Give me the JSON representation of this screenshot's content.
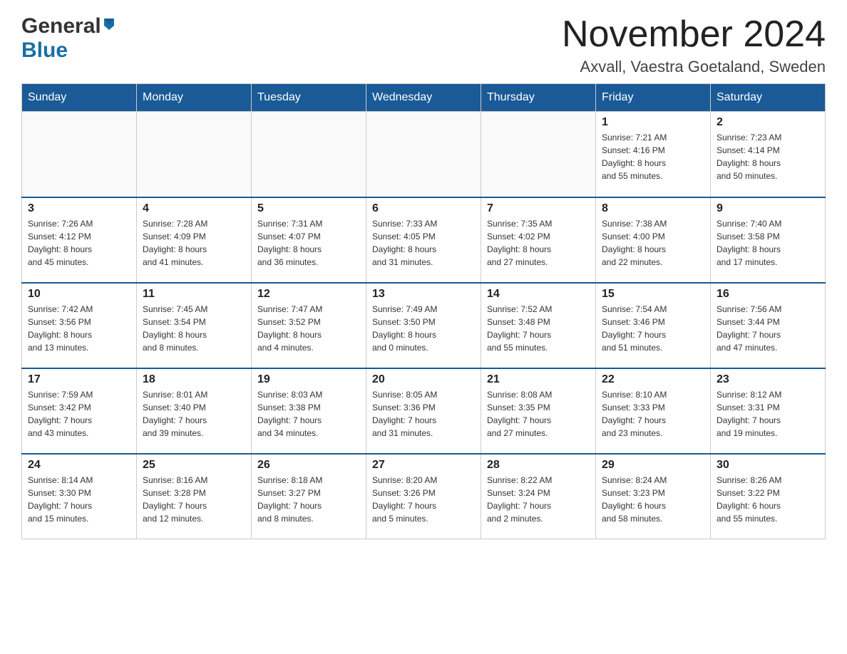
{
  "header": {
    "logo_general": "General",
    "logo_blue": "Blue",
    "month_title": "November 2024",
    "location": "Axvall, Vaestra Goetaland, Sweden"
  },
  "weekdays": [
    "Sunday",
    "Monday",
    "Tuesday",
    "Wednesday",
    "Thursday",
    "Friday",
    "Saturday"
  ],
  "weeks": [
    [
      {
        "day": "",
        "info": ""
      },
      {
        "day": "",
        "info": ""
      },
      {
        "day": "",
        "info": ""
      },
      {
        "day": "",
        "info": ""
      },
      {
        "day": "",
        "info": ""
      },
      {
        "day": "1",
        "info": "Sunrise: 7:21 AM\nSunset: 4:16 PM\nDaylight: 8 hours\nand 55 minutes."
      },
      {
        "day": "2",
        "info": "Sunrise: 7:23 AM\nSunset: 4:14 PM\nDaylight: 8 hours\nand 50 minutes."
      }
    ],
    [
      {
        "day": "3",
        "info": "Sunrise: 7:26 AM\nSunset: 4:12 PM\nDaylight: 8 hours\nand 45 minutes."
      },
      {
        "day": "4",
        "info": "Sunrise: 7:28 AM\nSunset: 4:09 PM\nDaylight: 8 hours\nand 41 minutes."
      },
      {
        "day": "5",
        "info": "Sunrise: 7:31 AM\nSunset: 4:07 PM\nDaylight: 8 hours\nand 36 minutes."
      },
      {
        "day": "6",
        "info": "Sunrise: 7:33 AM\nSunset: 4:05 PM\nDaylight: 8 hours\nand 31 minutes."
      },
      {
        "day": "7",
        "info": "Sunrise: 7:35 AM\nSunset: 4:02 PM\nDaylight: 8 hours\nand 27 minutes."
      },
      {
        "day": "8",
        "info": "Sunrise: 7:38 AM\nSunset: 4:00 PM\nDaylight: 8 hours\nand 22 minutes."
      },
      {
        "day": "9",
        "info": "Sunrise: 7:40 AM\nSunset: 3:58 PM\nDaylight: 8 hours\nand 17 minutes."
      }
    ],
    [
      {
        "day": "10",
        "info": "Sunrise: 7:42 AM\nSunset: 3:56 PM\nDaylight: 8 hours\nand 13 minutes."
      },
      {
        "day": "11",
        "info": "Sunrise: 7:45 AM\nSunset: 3:54 PM\nDaylight: 8 hours\nand 8 minutes."
      },
      {
        "day": "12",
        "info": "Sunrise: 7:47 AM\nSunset: 3:52 PM\nDaylight: 8 hours\nand 4 minutes."
      },
      {
        "day": "13",
        "info": "Sunrise: 7:49 AM\nSunset: 3:50 PM\nDaylight: 8 hours\nand 0 minutes."
      },
      {
        "day": "14",
        "info": "Sunrise: 7:52 AM\nSunset: 3:48 PM\nDaylight: 7 hours\nand 55 minutes."
      },
      {
        "day": "15",
        "info": "Sunrise: 7:54 AM\nSunset: 3:46 PM\nDaylight: 7 hours\nand 51 minutes."
      },
      {
        "day": "16",
        "info": "Sunrise: 7:56 AM\nSunset: 3:44 PM\nDaylight: 7 hours\nand 47 minutes."
      }
    ],
    [
      {
        "day": "17",
        "info": "Sunrise: 7:59 AM\nSunset: 3:42 PM\nDaylight: 7 hours\nand 43 minutes."
      },
      {
        "day": "18",
        "info": "Sunrise: 8:01 AM\nSunset: 3:40 PM\nDaylight: 7 hours\nand 39 minutes."
      },
      {
        "day": "19",
        "info": "Sunrise: 8:03 AM\nSunset: 3:38 PM\nDaylight: 7 hours\nand 34 minutes."
      },
      {
        "day": "20",
        "info": "Sunrise: 8:05 AM\nSunset: 3:36 PM\nDaylight: 7 hours\nand 31 minutes."
      },
      {
        "day": "21",
        "info": "Sunrise: 8:08 AM\nSunset: 3:35 PM\nDaylight: 7 hours\nand 27 minutes."
      },
      {
        "day": "22",
        "info": "Sunrise: 8:10 AM\nSunset: 3:33 PM\nDaylight: 7 hours\nand 23 minutes."
      },
      {
        "day": "23",
        "info": "Sunrise: 8:12 AM\nSunset: 3:31 PM\nDaylight: 7 hours\nand 19 minutes."
      }
    ],
    [
      {
        "day": "24",
        "info": "Sunrise: 8:14 AM\nSunset: 3:30 PM\nDaylight: 7 hours\nand 15 minutes."
      },
      {
        "day": "25",
        "info": "Sunrise: 8:16 AM\nSunset: 3:28 PM\nDaylight: 7 hours\nand 12 minutes."
      },
      {
        "day": "26",
        "info": "Sunrise: 8:18 AM\nSunset: 3:27 PM\nDaylight: 7 hours\nand 8 minutes."
      },
      {
        "day": "27",
        "info": "Sunrise: 8:20 AM\nSunset: 3:26 PM\nDaylight: 7 hours\nand 5 minutes."
      },
      {
        "day": "28",
        "info": "Sunrise: 8:22 AM\nSunset: 3:24 PM\nDaylight: 7 hours\nand 2 minutes."
      },
      {
        "day": "29",
        "info": "Sunrise: 8:24 AM\nSunset: 3:23 PM\nDaylight: 6 hours\nand 58 minutes."
      },
      {
        "day": "30",
        "info": "Sunrise: 8:26 AM\nSunset: 3:22 PM\nDaylight: 6 hours\nand 55 minutes."
      }
    ]
  ]
}
